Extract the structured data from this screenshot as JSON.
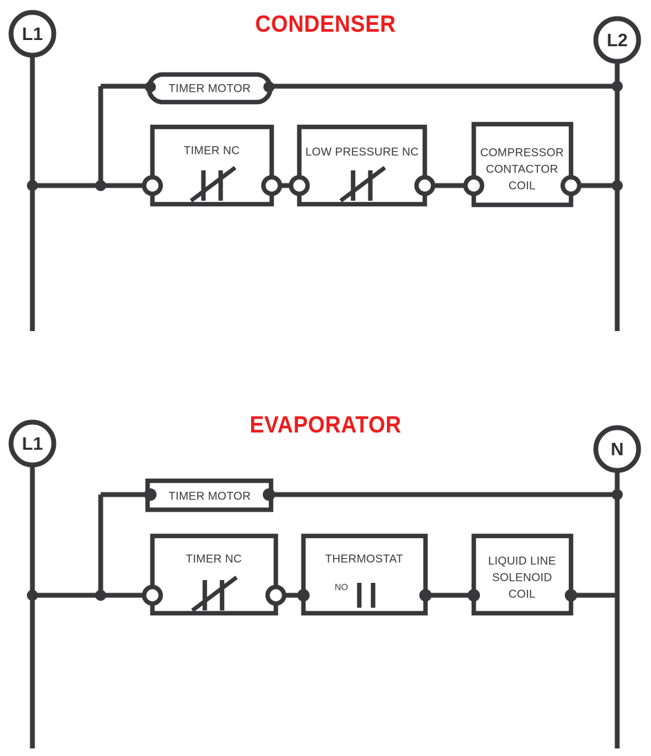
{
  "diagram": {
    "type": "electrical-ladder-wiring-diagram",
    "colors": {
      "title_red": "#ee1c1c",
      "wire_dark": "#38383a",
      "background": "#ffffff",
      "text_gray": "#3a3a3c"
    },
    "sections": [
      {
        "id": "condenser",
        "title": "CONDENSER",
        "left_terminal": "L1",
        "right_terminal": "L2",
        "rungs": [
          {
            "id": "condenser-timer-rung",
            "components": [
              {
                "name": "TIMER MOTOR",
                "shape": "stadium",
                "terminals": "filled"
              }
            ]
          },
          {
            "id": "condenser-control-rung",
            "components": [
              {
                "name": "TIMER NC",
                "shape": "rectangle",
                "symbol": "nc-contact",
                "terminals": "open"
              },
              {
                "name": "LOW PRESSURE NC",
                "shape": "rectangle",
                "symbol": "nc-contact",
                "terminals": "open"
              },
              {
                "name": "COMPRESSOR CONTACTOR COIL",
                "line1": "COMPRESSOR",
                "line2": "CONTACTOR",
                "line3": "COIL",
                "shape": "rectangle",
                "symbol": "coil",
                "terminals": "open"
              }
            ]
          }
        ]
      },
      {
        "id": "evaporator",
        "title": "EVAPORATOR",
        "left_terminal": "L1",
        "right_terminal": "N",
        "rungs": [
          {
            "id": "evaporator-timer-rung",
            "components": [
              {
                "name": "TIMER MOTOR",
                "shape": "rectangle",
                "terminals": "filled"
              }
            ]
          },
          {
            "id": "evaporator-control-rung",
            "components": [
              {
                "name": "TIMER NC",
                "shape": "rectangle",
                "symbol": "nc-contact",
                "terminals": "open"
              },
              {
                "name": "THERMOSTAT",
                "shape": "rectangle",
                "symbol": "no-contact",
                "contact_label": "NO",
                "terminals": "filled"
              },
              {
                "name": "LIQUID LINE SOLENOID COIL",
                "line1": "LIQUID LINE",
                "line2": "SOLENOID",
                "line3": "COIL",
                "shape": "rectangle",
                "symbol": "coil",
                "terminals": "filled"
              }
            ]
          }
        ]
      }
    ]
  },
  "condenser": {
    "title": "CONDENSER",
    "node_l1": "L1",
    "node_l2": "L2",
    "timer_motor": "TIMER MOTOR",
    "timer_nc": "TIMER NC",
    "low_pressure_nc": "LOW PRESSURE NC",
    "compressor_coil_line1": "COMPRESSOR",
    "compressor_coil_line2": "CONTACTOR",
    "compressor_coil_line3": "COIL"
  },
  "evaporator": {
    "title": "EVAPORATOR",
    "node_l1": "L1",
    "node_n": "N",
    "timer_motor": "TIMER MOTOR",
    "timer_nc": "TIMER NC",
    "thermostat": "THERMOSTAT",
    "thermostat_contact_label": "NO",
    "solenoid_line1": "LIQUID LINE",
    "solenoid_line2": "SOLENOID",
    "solenoid_line3": "COIL"
  }
}
